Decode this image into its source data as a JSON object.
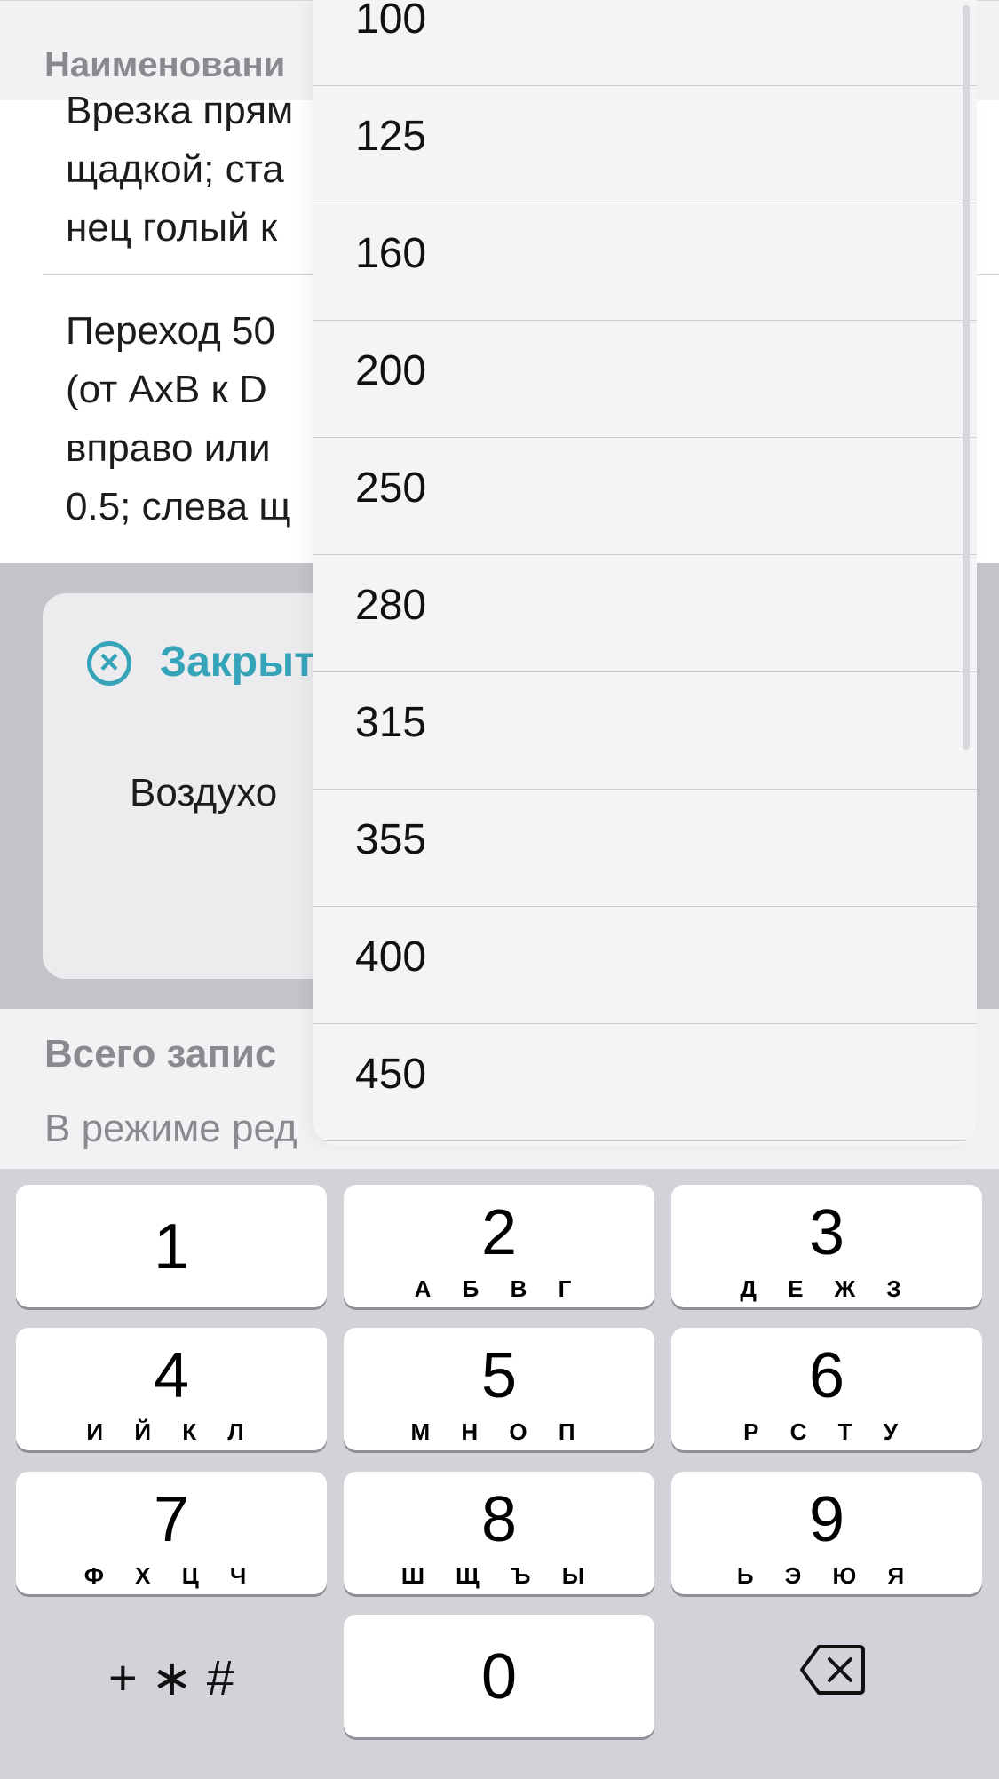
{
  "list": {
    "section_header": "Наименовани",
    "rows": [
      {
        "lines": [
          "Врезка прям",
          "щадкой; ста",
          "нец голый к"
        ]
      },
      {
        "lines": [
          "Переход 50",
          "(от AxB к D",
          "вправо или",
          "0.5; слева щ"
        ]
      }
    ]
  },
  "card": {
    "close_label": "Закрыт",
    "subtitle": "Воздухо"
  },
  "footer": {
    "title": "Всего запис",
    "subtitle": "В режиме ред"
  },
  "dropdown": {
    "options": [
      "100",
      "125",
      "160",
      "200",
      "250",
      "280",
      "315",
      "355",
      "400",
      "450"
    ]
  },
  "keypad": {
    "keys": [
      {
        "num": "1",
        "letters": ""
      },
      {
        "num": "2",
        "letters": "А Б В Г"
      },
      {
        "num": "3",
        "letters": "Д Е Ж З"
      },
      {
        "num": "4",
        "letters": "И Й К Л"
      },
      {
        "num": "5",
        "letters": "М Н О П"
      },
      {
        "num": "6",
        "letters": "Р С Т У"
      },
      {
        "num": "7",
        "letters": "Ф Х Ц Ч"
      },
      {
        "num": "8",
        "letters": "Ш Щ Ъ Ы"
      },
      {
        "num": "9",
        "letters": "Ь Э Ю Я"
      },
      {
        "num": "0",
        "letters": ""
      }
    ],
    "symbols": "+ ∗ #",
    "backspace_icon": "backspace-icon"
  }
}
